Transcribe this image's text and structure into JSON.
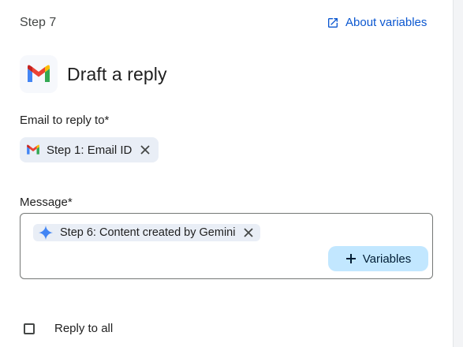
{
  "header": {
    "step_label": "Step 7",
    "about_link_label": "About variables"
  },
  "action": {
    "app_icon": "gmail-icon",
    "title": "Draft a reply"
  },
  "email_field": {
    "label": "Email to reply to*",
    "chip_label": "Step 1: Email ID",
    "chip_icon": "gmail-icon"
  },
  "message_field": {
    "label": "Message*",
    "chip_label": "Step 6: Content created by Gemini",
    "chip_icon": "gemini-sparkle-icon",
    "variables_button_label": "Variables"
  },
  "reply_all": {
    "label": "Reply to all",
    "checked": false
  },
  "colors": {
    "link": "#0b57d0",
    "chip_bg": "#e9eef6",
    "button_bg": "#c2e7ff",
    "gemini_blue": "#4285f4"
  }
}
